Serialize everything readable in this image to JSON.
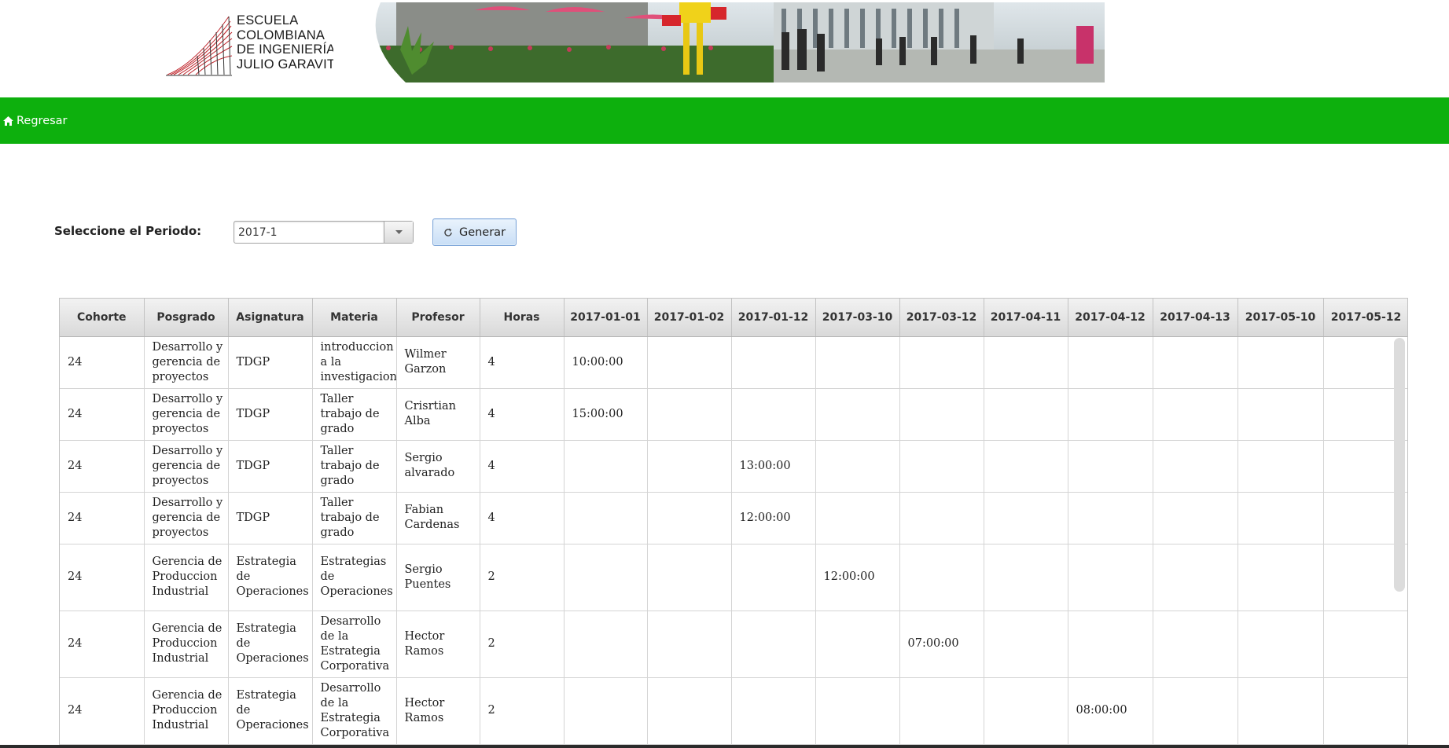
{
  "header": {
    "logo_lines": [
      "ESCUELA",
      "COLOMBIANA",
      "DE INGENIERÍA",
      "JULIO GARAVITO"
    ]
  },
  "nav": {
    "home_label": "Regresar"
  },
  "form": {
    "period_label": "Seleccione el Periodo:",
    "period_value": "2017-1",
    "generate_label": "Generar"
  },
  "grid": {
    "columns": [
      "Cohorte",
      "Posgrado",
      "Asignatura",
      "Materia",
      "Profesor",
      "Horas",
      "2017-01-01",
      "2017-01-02",
      "2017-01-12",
      "2017-03-10",
      "2017-03-12",
      "2017-04-11",
      "2017-04-12",
      "2017-04-13",
      "2017-05-10",
      "2017-05-12"
    ],
    "rows": [
      [
        "24",
        "Desarrollo y gerencia de proyectos",
        "TDGP",
        "introduccion a la investigacion",
        "Wilmer Garzon",
        "4",
        "10:00:00",
        "",
        "",
        "",
        "",
        "",
        "",
        "",
        "",
        ""
      ],
      [
        "24",
        "Desarrollo y gerencia de proyectos",
        "TDGP",
        "Taller trabajo de grado",
        "Crisrtian Alba",
        "4",
        "15:00:00",
        "",
        "",
        "",
        "",
        "",
        "",
        "",
        "",
        ""
      ],
      [
        "24",
        "Desarrollo y gerencia de proyectos",
        "TDGP",
        "Taller trabajo de grado",
        "Sergio alvarado",
        "4",
        "",
        "",
        "13:00:00",
        "",
        "",
        "",
        "",
        "",
        "",
        ""
      ],
      [
        "24",
        "Desarrollo y gerencia de proyectos",
        "TDGP",
        "Taller trabajo de grado",
        "Fabian Cardenas",
        "4",
        "",
        "",
        "12:00:00",
        "",
        "",
        "",
        "",
        "",
        "",
        ""
      ],
      [
        "24",
        "Gerencia de Produccion Industrial",
        "Estrategia de Operaciones",
        "Estrategias de Operaciones",
        "Sergio Puentes",
        "2",
        "",
        "",
        "",
        "12:00:00",
        "",
        "",
        "",
        "",
        "",
        ""
      ],
      [
        "24",
        "Gerencia de Produccion Industrial",
        "Estrategia de Operaciones",
        "Desarrollo de la Estrategia Corporativa",
        "Hector Ramos",
        "2",
        "",
        "",
        "",
        "",
        "07:00:00",
        "",
        "",
        "",
        "",
        ""
      ],
      [
        "24",
        "Gerencia de Produccion Industrial",
        "Estrategia de Operaciones",
        "Desarrollo de la Estrategia Corporativa",
        "Hector Ramos",
        "2",
        "",
        "",
        "",
        "",
        "",
        "",
        "08:00:00",
        "",
        "",
        ""
      ]
    ]
  },
  "icons": {
    "home": "home-icon",
    "refresh": "refresh-icon",
    "dropdown": "chevron-down-icon"
  },
  "colors": {
    "navbar": "#0db00d",
    "button": "#c8def6"
  }
}
